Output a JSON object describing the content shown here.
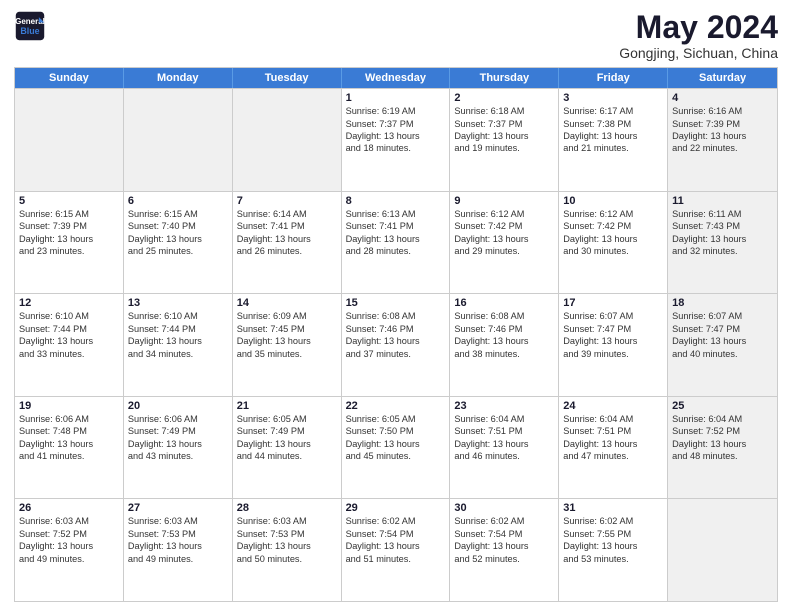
{
  "header": {
    "logo_line1": "General",
    "logo_line2": "Blue",
    "main_title": "May 2024",
    "subtitle": "Gongjing, Sichuan, China"
  },
  "weekdays": [
    "Sunday",
    "Monday",
    "Tuesday",
    "Wednesday",
    "Thursday",
    "Friday",
    "Saturday"
  ],
  "rows": [
    [
      {
        "day": "",
        "info": "",
        "shaded": true
      },
      {
        "day": "",
        "info": "",
        "shaded": true
      },
      {
        "day": "",
        "info": "",
        "shaded": true
      },
      {
        "day": "1",
        "info": "Sunrise: 6:19 AM\nSunset: 7:37 PM\nDaylight: 13 hours\nand 18 minutes.",
        "shaded": false
      },
      {
        "day": "2",
        "info": "Sunrise: 6:18 AM\nSunset: 7:37 PM\nDaylight: 13 hours\nand 19 minutes.",
        "shaded": false
      },
      {
        "day": "3",
        "info": "Sunrise: 6:17 AM\nSunset: 7:38 PM\nDaylight: 13 hours\nand 21 minutes.",
        "shaded": false
      },
      {
        "day": "4",
        "info": "Sunrise: 6:16 AM\nSunset: 7:39 PM\nDaylight: 13 hours\nand 22 minutes.",
        "shaded": true
      }
    ],
    [
      {
        "day": "5",
        "info": "Sunrise: 6:15 AM\nSunset: 7:39 PM\nDaylight: 13 hours\nand 23 minutes.",
        "shaded": false
      },
      {
        "day": "6",
        "info": "Sunrise: 6:15 AM\nSunset: 7:40 PM\nDaylight: 13 hours\nand 25 minutes.",
        "shaded": false
      },
      {
        "day": "7",
        "info": "Sunrise: 6:14 AM\nSunset: 7:41 PM\nDaylight: 13 hours\nand 26 minutes.",
        "shaded": false
      },
      {
        "day": "8",
        "info": "Sunrise: 6:13 AM\nSunset: 7:41 PM\nDaylight: 13 hours\nand 28 minutes.",
        "shaded": false
      },
      {
        "day": "9",
        "info": "Sunrise: 6:12 AM\nSunset: 7:42 PM\nDaylight: 13 hours\nand 29 minutes.",
        "shaded": false
      },
      {
        "day": "10",
        "info": "Sunrise: 6:12 AM\nSunset: 7:42 PM\nDaylight: 13 hours\nand 30 minutes.",
        "shaded": false
      },
      {
        "day": "11",
        "info": "Sunrise: 6:11 AM\nSunset: 7:43 PM\nDaylight: 13 hours\nand 32 minutes.",
        "shaded": true
      }
    ],
    [
      {
        "day": "12",
        "info": "Sunrise: 6:10 AM\nSunset: 7:44 PM\nDaylight: 13 hours\nand 33 minutes.",
        "shaded": false
      },
      {
        "day": "13",
        "info": "Sunrise: 6:10 AM\nSunset: 7:44 PM\nDaylight: 13 hours\nand 34 minutes.",
        "shaded": false
      },
      {
        "day": "14",
        "info": "Sunrise: 6:09 AM\nSunset: 7:45 PM\nDaylight: 13 hours\nand 35 minutes.",
        "shaded": false
      },
      {
        "day": "15",
        "info": "Sunrise: 6:08 AM\nSunset: 7:46 PM\nDaylight: 13 hours\nand 37 minutes.",
        "shaded": false
      },
      {
        "day": "16",
        "info": "Sunrise: 6:08 AM\nSunset: 7:46 PM\nDaylight: 13 hours\nand 38 minutes.",
        "shaded": false
      },
      {
        "day": "17",
        "info": "Sunrise: 6:07 AM\nSunset: 7:47 PM\nDaylight: 13 hours\nand 39 minutes.",
        "shaded": false
      },
      {
        "day": "18",
        "info": "Sunrise: 6:07 AM\nSunset: 7:47 PM\nDaylight: 13 hours\nand 40 minutes.",
        "shaded": true
      }
    ],
    [
      {
        "day": "19",
        "info": "Sunrise: 6:06 AM\nSunset: 7:48 PM\nDaylight: 13 hours\nand 41 minutes.",
        "shaded": false
      },
      {
        "day": "20",
        "info": "Sunrise: 6:06 AM\nSunset: 7:49 PM\nDaylight: 13 hours\nand 43 minutes.",
        "shaded": false
      },
      {
        "day": "21",
        "info": "Sunrise: 6:05 AM\nSunset: 7:49 PM\nDaylight: 13 hours\nand 44 minutes.",
        "shaded": false
      },
      {
        "day": "22",
        "info": "Sunrise: 6:05 AM\nSunset: 7:50 PM\nDaylight: 13 hours\nand 45 minutes.",
        "shaded": false
      },
      {
        "day": "23",
        "info": "Sunrise: 6:04 AM\nSunset: 7:51 PM\nDaylight: 13 hours\nand 46 minutes.",
        "shaded": false
      },
      {
        "day": "24",
        "info": "Sunrise: 6:04 AM\nSunset: 7:51 PM\nDaylight: 13 hours\nand 47 minutes.",
        "shaded": false
      },
      {
        "day": "25",
        "info": "Sunrise: 6:04 AM\nSunset: 7:52 PM\nDaylight: 13 hours\nand 48 minutes.",
        "shaded": true
      }
    ],
    [
      {
        "day": "26",
        "info": "Sunrise: 6:03 AM\nSunset: 7:52 PM\nDaylight: 13 hours\nand 49 minutes.",
        "shaded": false
      },
      {
        "day": "27",
        "info": "Sunrise: 6:03 AM\nSunset: 7:53 PM\nDaylight: 13 hours\nand 49 minutes.",
        "shaded": false
      },
      {
        "day": "28",
        "info": "Sunrise: 6:03 AM\nSunset: 7:53 PM\nDaylight: 13 hours\nand 50 minutes.",
        "shaded": false
      },
      {
        "day": "29",
        "info": "Sunrise: 6:02 AM\nSunset: 7:54 PM\nDaylight: 13 hours\nand 51 minutes.",
        "shaded": false
      },
      {
        "day": "30",
        "info": "Sunrise: 6:02 AM\nSunset: 7:54 PM\nDaylight: 13 hours\nand 52 minutes.",
        "shaded": false
      },
      {
        "day": "31",
        "info": "Sunrise: 6:02 AM\nSunset: 7:55 PM\nDaylight: 13 hours\nand 53 minutes.",
        "shaded": false
      },
      {
        "day": "",
        "info": "",
        "shaded": true
      }
    ]
  ]
}
